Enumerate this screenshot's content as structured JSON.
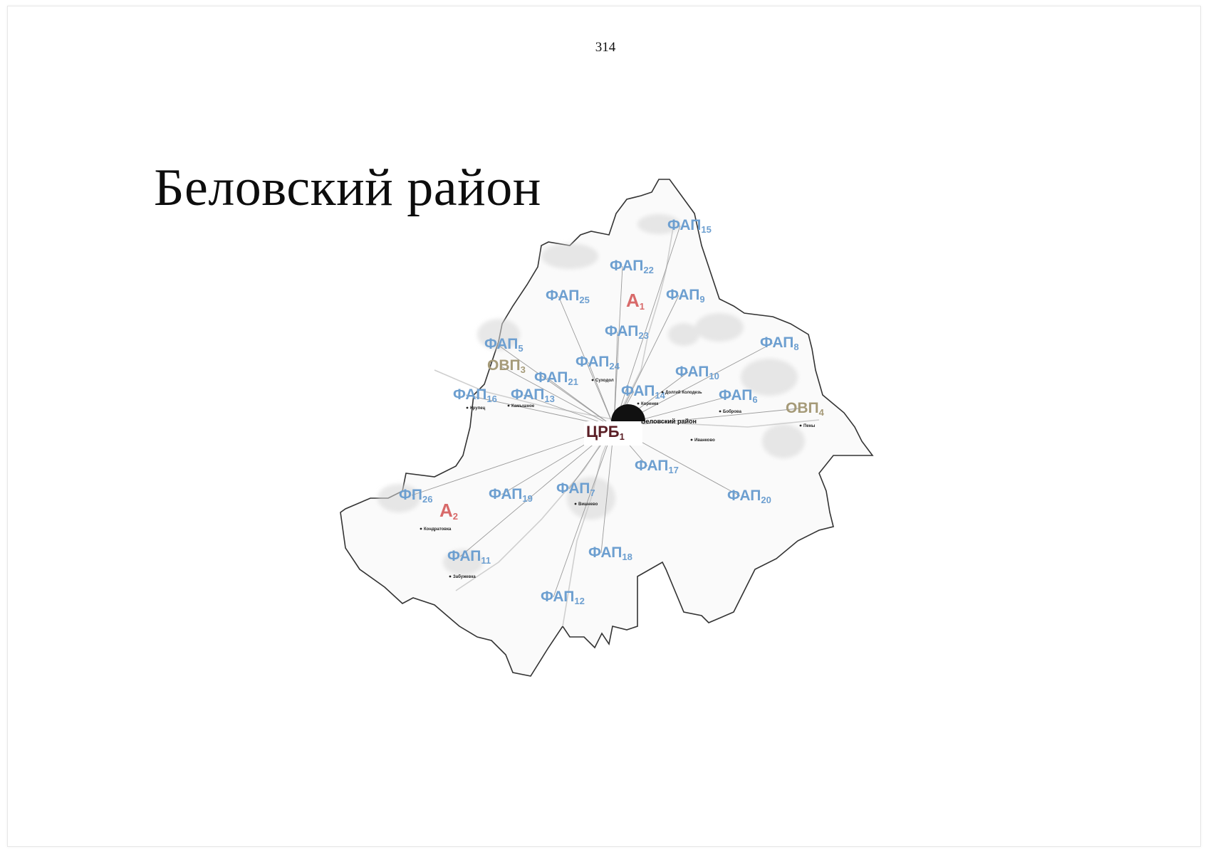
{
  "page_number": "314",
  "title": "Беловский район",
  "hub": {
    "name": "ЦРБ",
    "index": "1"
  },
  "district_label": "Беловский район",
  "facilities": [
    {
      "type": "fap",
      "name": "ФАП",
      "index": "15"
    },
    {
      "type": "fap",
      "name": "ФАП",
      "index": "22"
    },
    {
      "type": "fap",
      "name": "ФАП",
      "index": "25"
    },
    {
      "type": "fap",
      "name": "ФАП",
      "index": "9"
    },
    {
      "type": "ambulance",
      "name": "А",
      "index": "1"
    },
    {
      "type": "fap",
      "name": "ФАП",
      "index": "23"
    },
    {
      "type": "fap",
      "name": "ФАП",
      "index": "8"
    },
    {
      "type": "fap",
      "name": "ФАП",
      "index": "5"
    },
    {
      "type": "ovp",
      "name": "ОВП",
      "index": "3"
    },
    {
      "type": "fap",
      "name": "ФАП",
      "index": "24"
    },
    {
      "type": "fap",
      "name": "ФАП",
      "index": "21"
    },
    {
      "type": "fap",
      "name": "ФАП",
      "index": "10"
    },
    {
      "type": "fap",
      "name": "ФАП",
      "index": "16"
    },
    {
      "type": "fap",
      "name": "ФАП",
      "index": "13"
    },
    {
      "type": "fap",
      "name": "ФАП",
      "index": "14"
    },
    {
      "type": "fap",
      "name": "ФАП",
      "index": "6"
    },
    {
      "type": "ovp",
      "name": "ОВП",
      "index": "4"
    },
    {
      "type": "fap",
      "name": "ФАП",
      "index": "17"
    },
    {
      "type": "fap",
      "name": "ФП",
      "index": "26"
    },
    {
      "type": "ambulance",
      "name": "А",
      "index": "2"
    },
    {
      "type": "fap",
      "name": "ФАП",
      "index": "19"
    },
    {
      "type": "fap",
      "name": "ФАП",
      "index": "7"
    },
    {
      "type": "fap",
      "name": "ФАП",
      "index": "20"
    },
    {
      "type": "fap",
      "name": "ФАП",
      "index": "11"
    },
    {
      "type": "fap",
      "name": "ФАП",
      "index": "18"
    },
    {
      "type": "fap",
      "name": "ФАП",
      "index": "12"
    }
  ],
  "villages": [
    "Крупец",
    "Камышное",
    "Беловский район",
    "Боброва",
    "Пены",
    "Вишнево",
    "Кондратовка",
    "Забужевка",
    "Коренек",
    "Иванково",
    "Долгий Колодезь",
    "Суходол"
  ],
  "colors": {
    "fap": "#6d9fd0",
    "ovp": "#a59a78",
    "ambulance": "#d86a6a",
    "hub": "#5a1e25",
    "border": "#333333",
    "link": "#9a9a9a"
  }
}
